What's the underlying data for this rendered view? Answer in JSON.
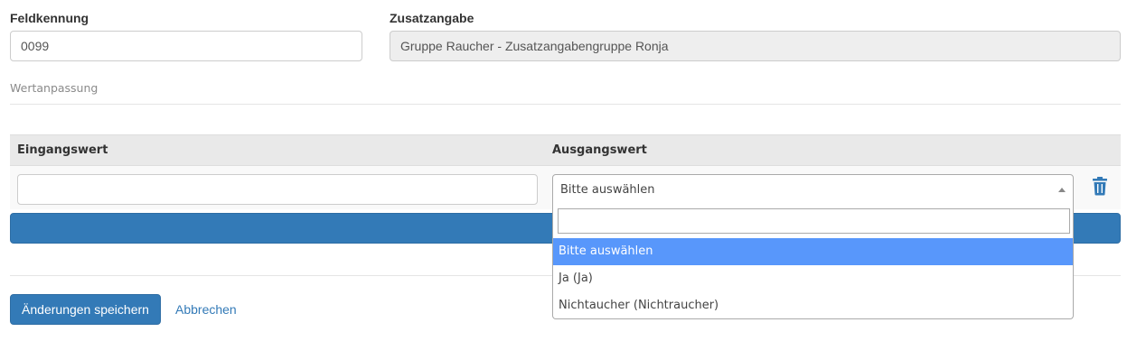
{
  "form": {
    "feldkennung": {
      "label": "Feldkennung",
      "value": "0099"
    },
    "zusatzangabe": {
      "label": "Zusatzangabe",
      "value": "Gruppe Raucher - Zusatzangabengruppe Ronja"
    }
  },
  "section": {
    "title": "Wertanpassung"
  },
  "table": {
    "headers": {
      "input": "Eingangswert",
      "output": "Ausgangswert"
    },
    "row": {
      "input_value": "",
      "output_selected": "Bitte auswählen"
    }
  },
  "dropdown": {
    "search_value": "",
    "options": [
      "Bitte auswählen",
      "Ja (Ja)",
      "Nichtaucher (Nichtraucher)"
    ],
    "highlighted": "Bitte auswählen"
  },
  "actions": {
    "save_label": "Änderungen speichern",
    "cancel_label": "Abbrechen"
  },
  "colors": {
    "primary": "#337ab7",
    "highlight": "#5897fb",
    "readonly_bg": "#eeeeee"
  },
  "icons": {
    "delete": "trash-icon",
    "select_arrow": "caret-up-icon"
  }
}
